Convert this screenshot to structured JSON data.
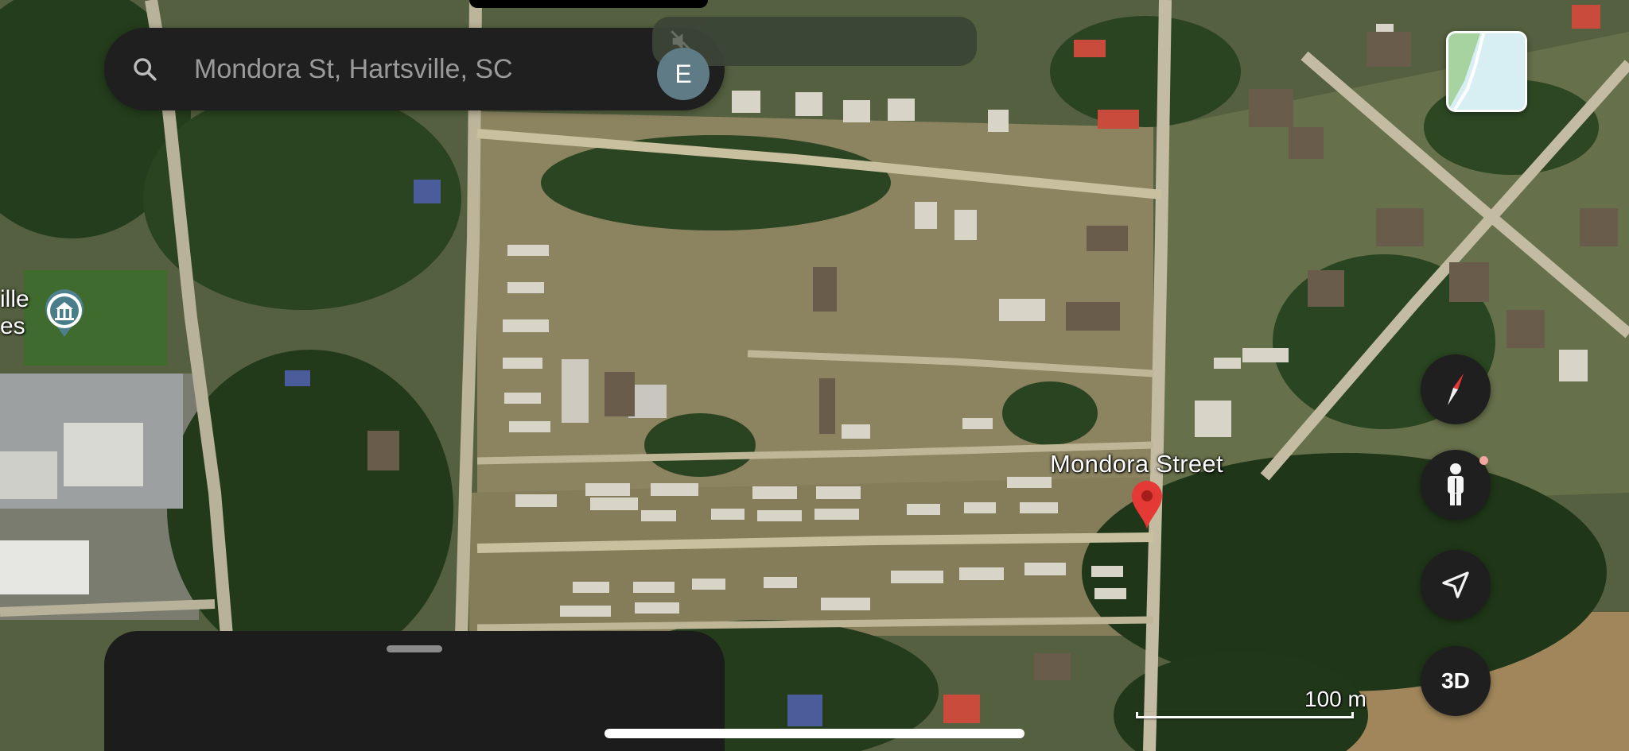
{
  "search": {
    "placeholder": "Mondora St, Hartsville, SC",
    "avatar_letter": "E"
  },
  "map": {
    "street_label": "Mondora Street",
    "place_label_line1": "ille",
    "place_label_line2": "es",
    "scale_label": "100 m",
    "view": "satellite"
  },
  "controls": {
    "three_d_label": "3D"
  },
  "icons": {
    "search": "search-icon",
    "mute": "speaker-muted-icon",
    "pin": "location-pin-icon",
    "compass": "compass-icon",
    "pegman": "street-view-pegman-icon",
    "locate": "my-location-arrow-icon",
    "place": "gazebo-place-icon",
    "layers": "map-layer-thumbnail"
  },
  "colors": {
    "pin": "#e53935",
    "panel": "#1f1f1f",
    "compass_red": "#e53935"
  }
}
